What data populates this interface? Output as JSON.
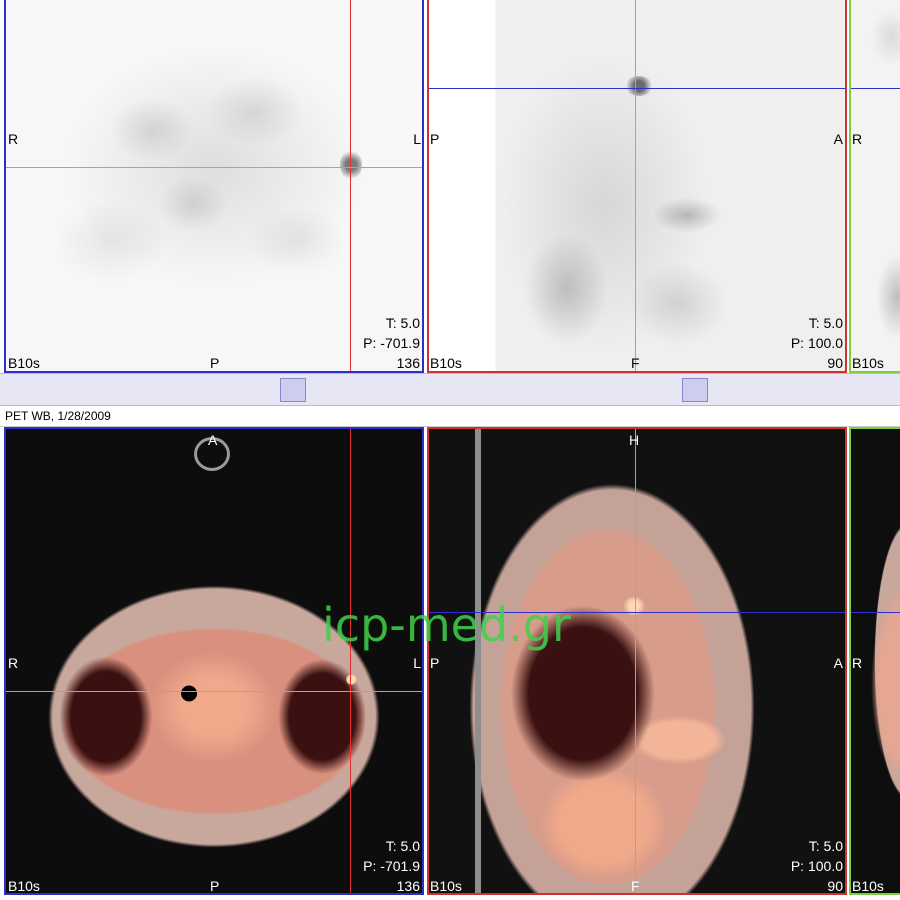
{
  "series": {
    "title": "PET WB, 1/28/2009"
  },
  "watermark": "icp-med.gr",
  "colors": {
    "axial_frame": "#2e2ec8",
    "sagittal_frame": "#d03030",
    "coronal_frame": "#7acf3a",
    "crosshair_red": "#e03030",
    "crosshair_green": "#7acf3a",
    "crosshair_blue": "#2e2ec8",
    "watermark": "#3fd34a"
  },
  "viewports": {
    "pet_axial": {
      "left_label": "R",
      "right_label": "L",
      "bottom_label": "P",
      "kernel": "B10s",
      "slice": "136",
      "t_value": "T: 5.0",
      "p_value": "P: -701.9"
    },
    "pet_sagittal": {
      "left_label": "P",
      "right_label": "A",
      "bottom_label": "F",
      "kernel": "B10s",
      "slice": "90",
      "t_value": "T: 5.0",
      "p_value": "P: 100.0"
    },
    "pet_coronal": {
      "left_label": "R",
      "kernel": "B10s"
    },
    "fused_axial": {
      "top_label": "A",
      "left_label": "R",
      "right_label": "L",
      "bottom_label": "P",
      "kernel": "B10s",
      "slice": "136",
      "t_value": "T: 5.0",
      "p_value": "P: -701.9"
    },
    "fused_sagittal": {
      "top_label": "H",
      "left_label": "P",
      "right_label": "A",
      "bottom_label": "F",
      "kernel": "B10s",
      "slice": "90",
      "t_value": "T: 5.0",
      "p_value": "P: 100.0"
    },
    "fused_coronal": {
      "left_label": "R",
      "kernel": "B10s"
    }
  }
}
